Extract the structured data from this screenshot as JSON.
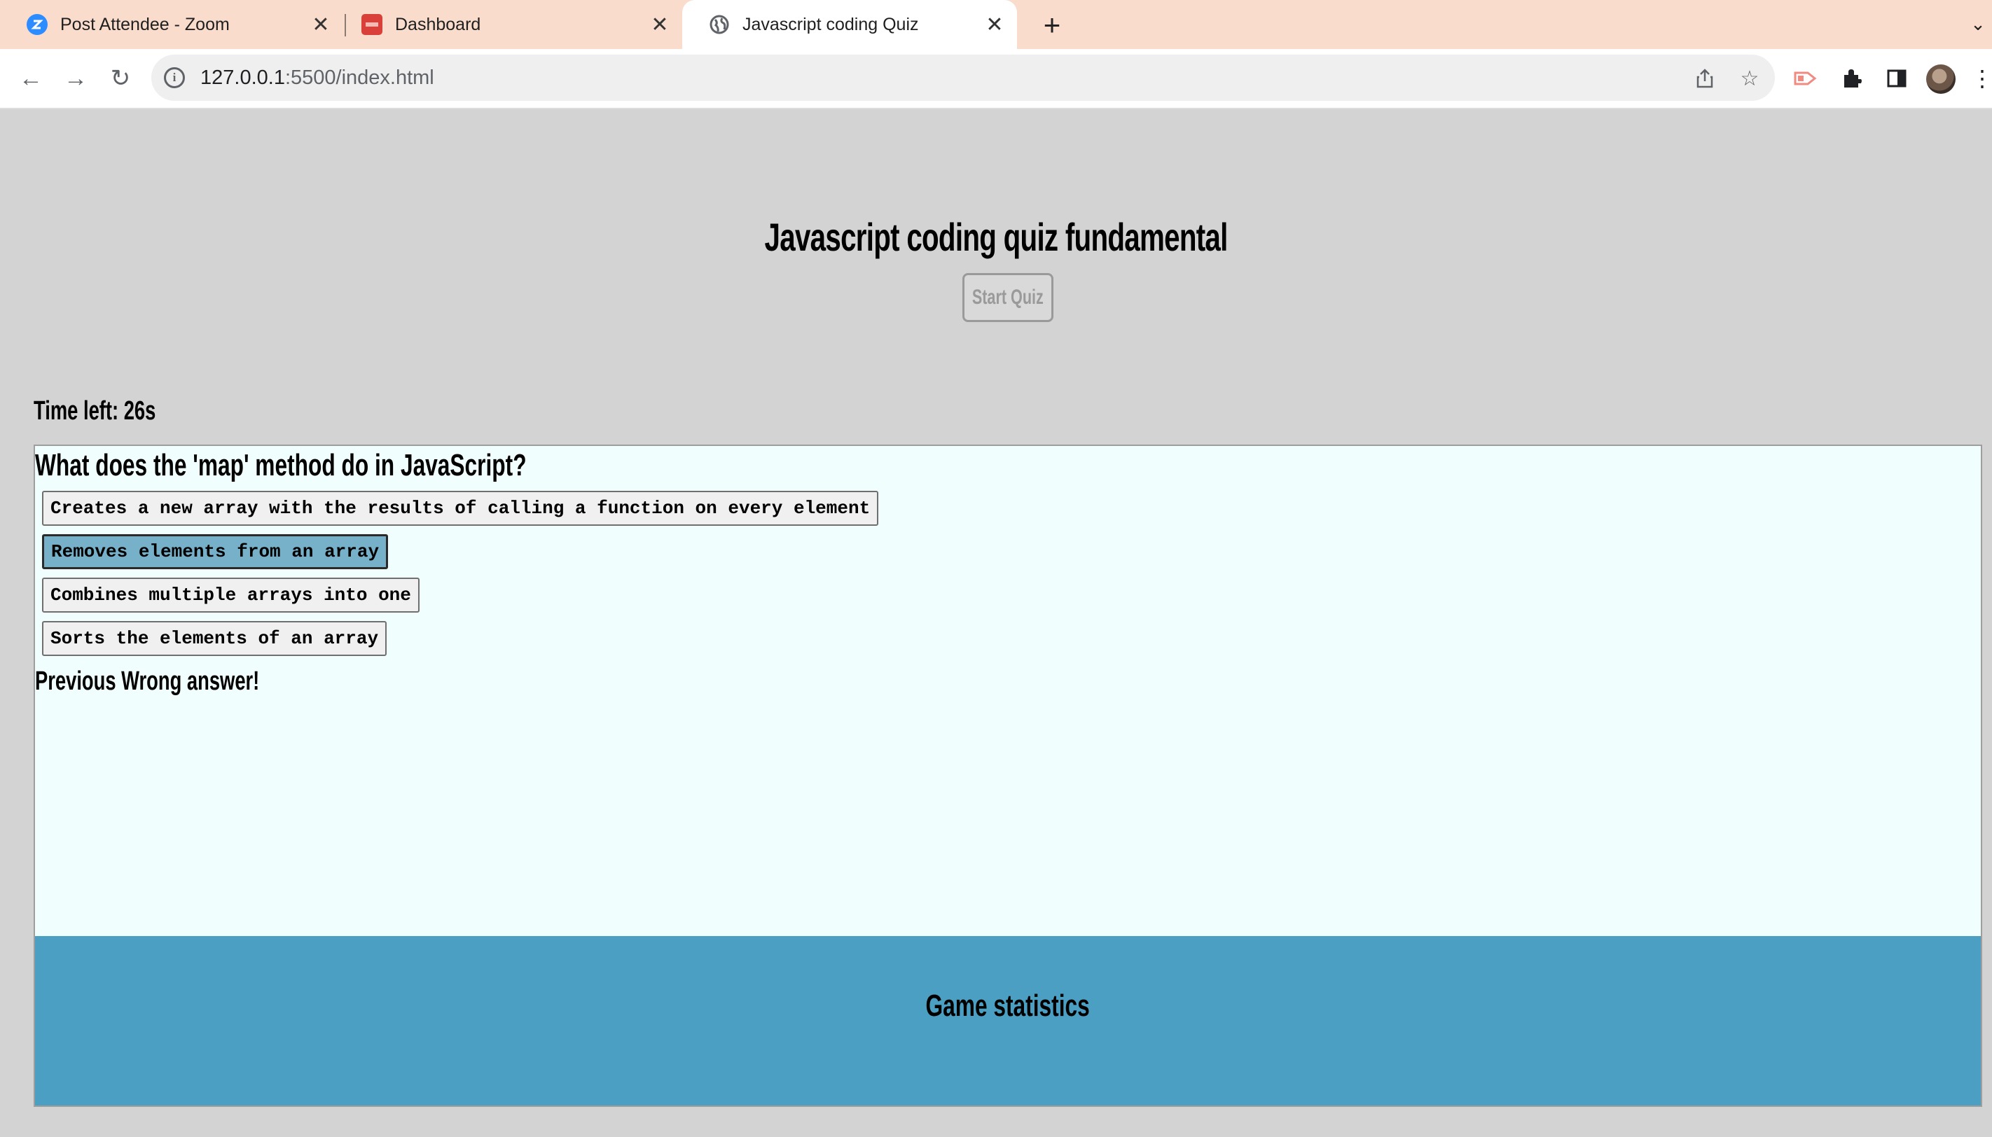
{
  "browser": {
    "tabs": [
      {
        "title": "Post Attendee - Zoom",
        "favicon": "zoom-icon",
        "active": false
      },
      {
        "title": "Dashboard",
        "favicon": "dashboard-favicon",
        "active": false
      },
      {
        "title": "Javascript coding Quiz",
        "favicon": "globe-icon",
        "active": true
      }
    ],
    "url_host": "127.0.0.1",
    "url_rest": ":5500/index.html",
    "colors": {
      "tabstrip": "#f9dccc",
      "toolbar": "#ffffff"
    }
  },
  "page": {
    "title": "Javascript coding quiz fundamental",
    "start_button": "Start Quiz",
    "timer": "Time left: 26s",
    "question": "What does the 'map' method do in JavaScript?",
    "answers": [
      {
        "label": "Creates a new array with the results of calling a function on every element",
        "selected": false
      },
      {
        "label": "Removes elements from an array",
        "selected": true
      },
      {
        "label": "Combines multiple arrays into one",
        "selected": false
      },
      {
        "label": "Sorts the elements of an array",
        "selected": false
      }
    ],
    "feedback": "Previous Wrong answer!",
    "stats_title": "Game statistics",
    "colors": {
      "background": "#d3d3d3",
      "quiz_box": "#f0fefd",
      "stats": "#4b9fc3",
      "selected_answer": "#76b0c9"
    }
  }
}
